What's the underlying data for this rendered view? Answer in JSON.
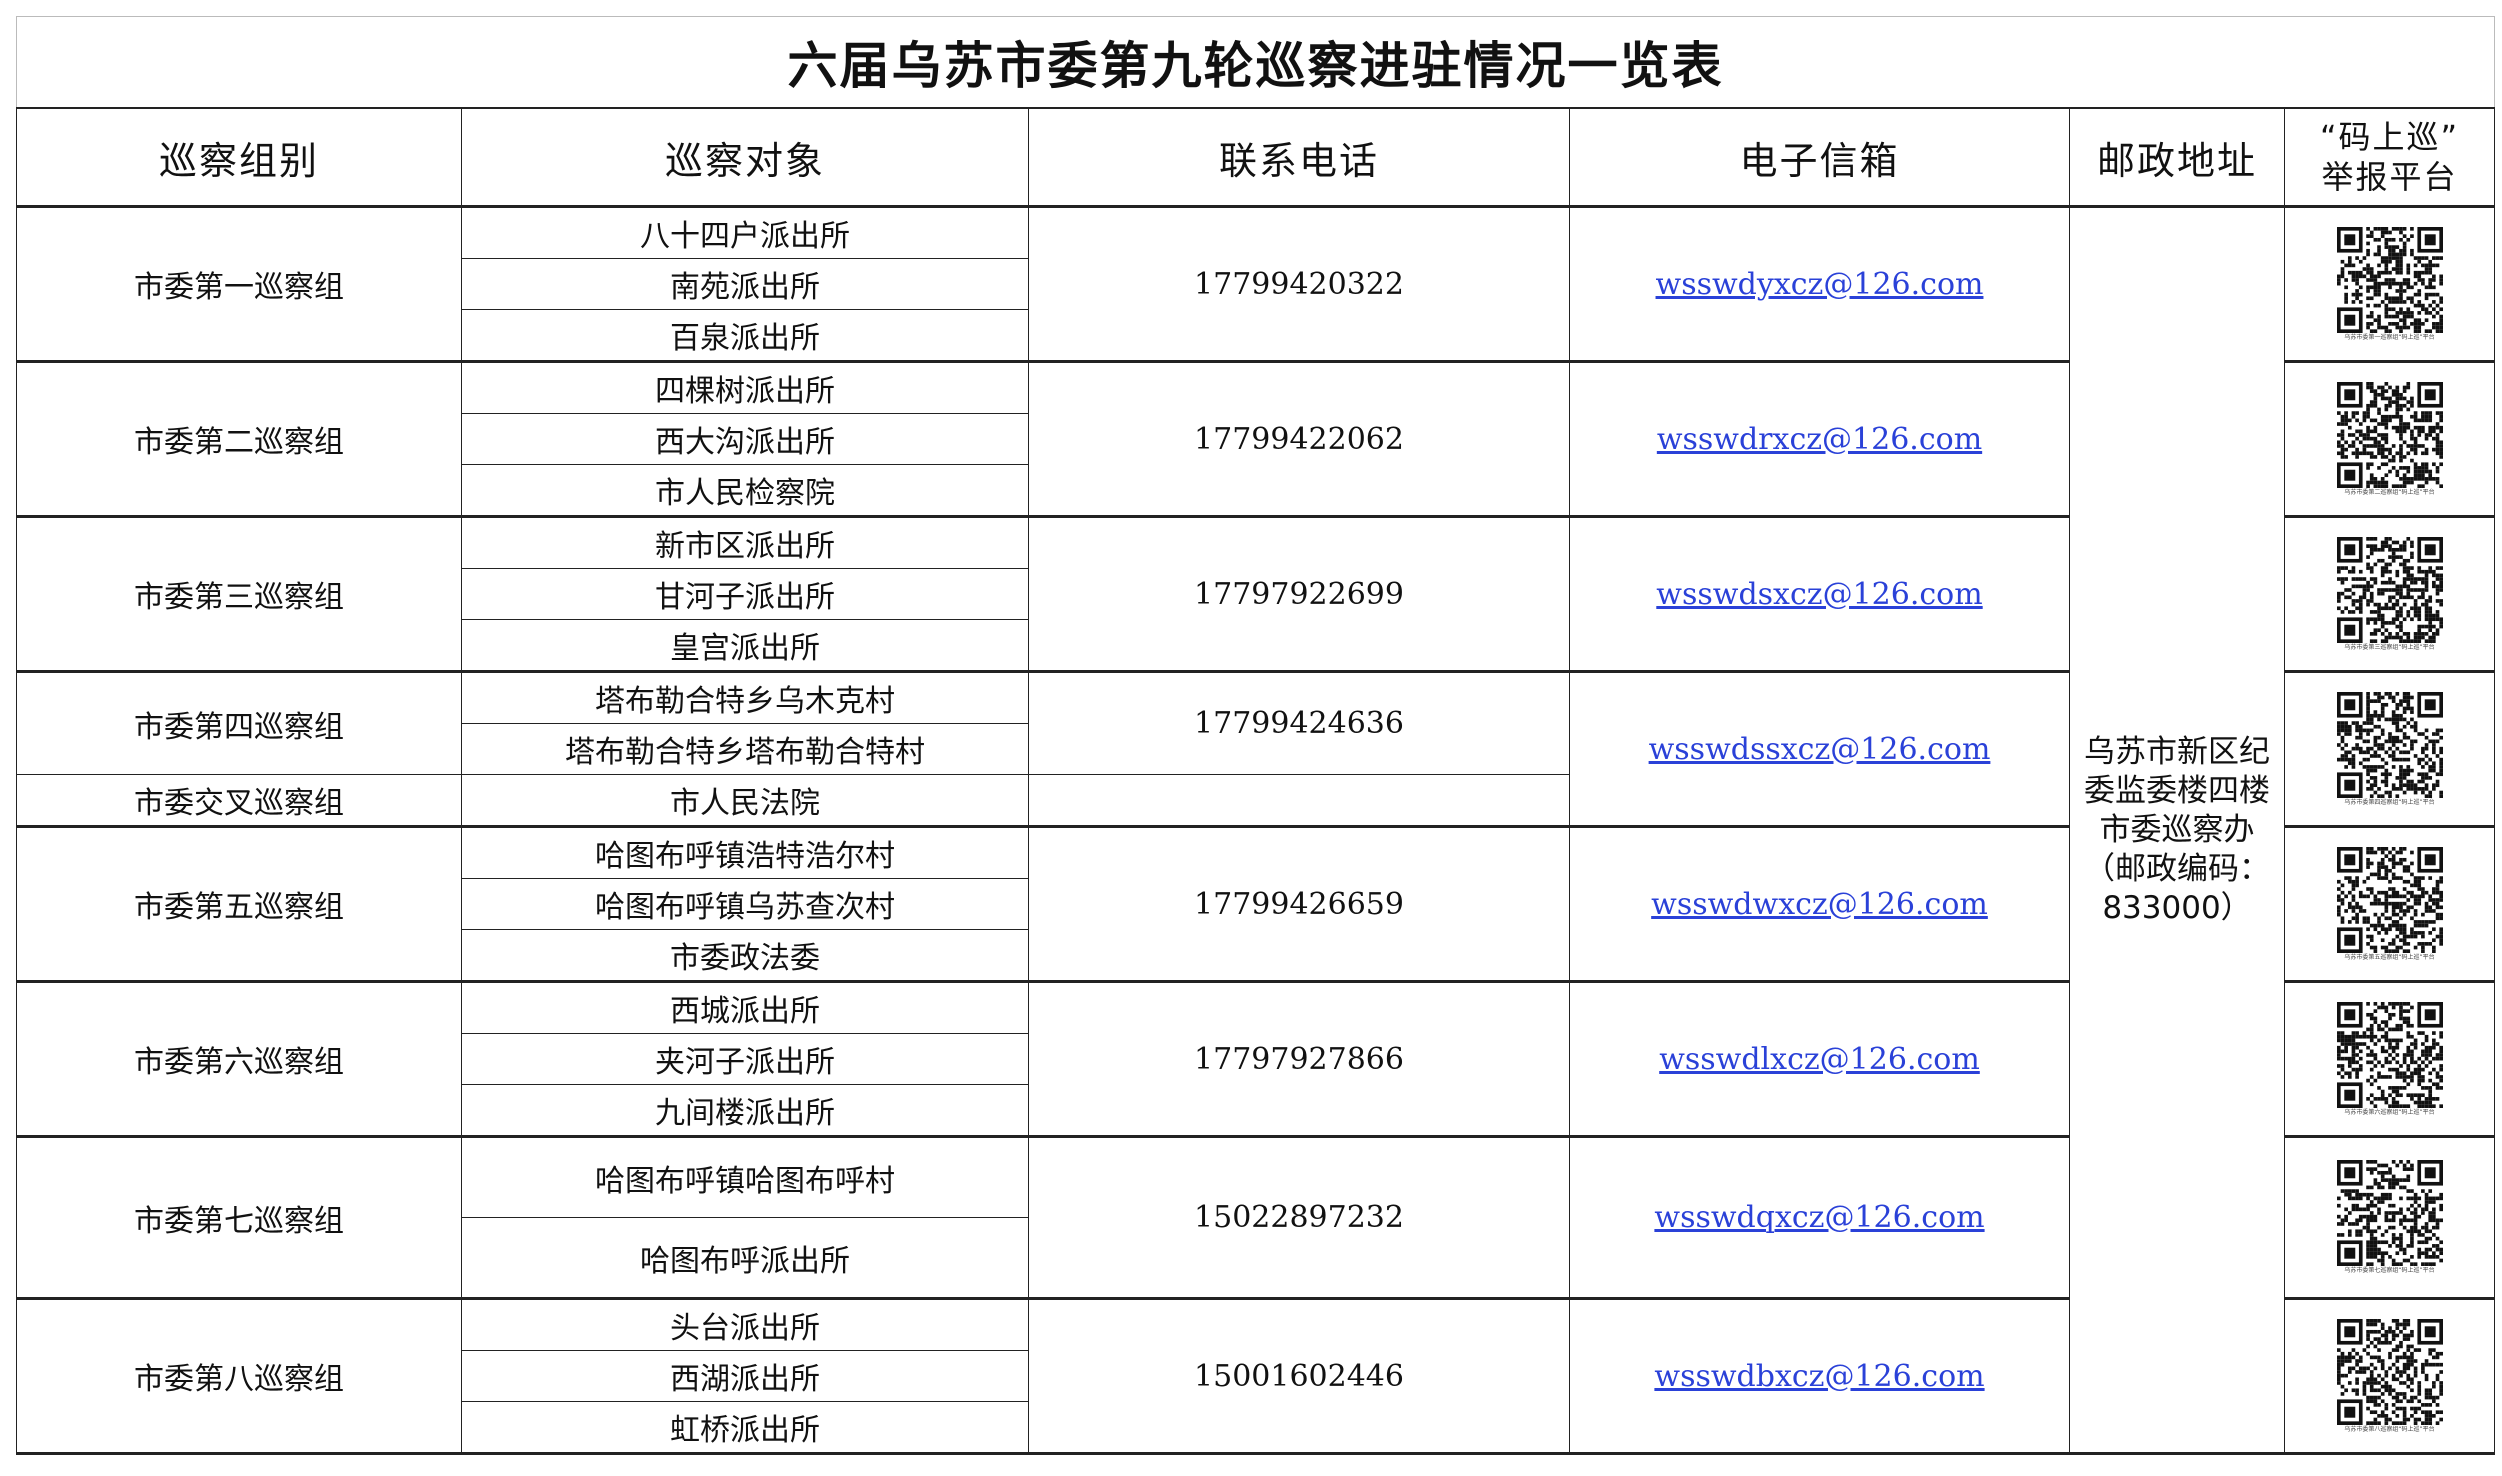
{
  "title": "六届乌苏市委第九轮巡察进驻情况一览表",
  "headers": {
    "group": "巡察组别",
    "target": "巡察对象",
    "phone": "联系电话",
    "email": "电子信箱",
    "address": "邮政地址",
    "qr_line1": "“码上巡”",
    "qr_line2": "举报平台"
  },
  "address": {
    "line1": "乌苏市新区纪",
    "line2": "委监委楼四楼",
    "line3": "市委巡察办",
    "line4": "（邮政编码：",
    "line5": "833000）"
  },
  "blocks": [
    {
      "group": "市委第一巡察组",
      "targets": [
        "八十四户派出所",
        "南苑派出所",
        "百泉派出所"
      ],
      "phone": "17799420322",
      "email": "wsswdyxcz@126.com",
      "qr_caption": "乌苏市委第一巡察组“码上巡”平台"
    },
    {
      "group": "市委第二巡察组",
      "targets": [
        "四棵树派出所",
        "西大沟派出所",
        "市人民检察院"
      ],
      "phone": "17799422062",
      "email": "wsswdrxcz@126.com",
      "qr_caption": "乌苏市委第二巡察组“码上巡”平台"
    },
    {
      "group": "市委第三巡察组",
      "targets": [
        "新市区派出所",
        "甘河子派出所",
        "皇宫派出所"
      ],
      "phone": "17797922699",
      "email": "wsswdsxcz@126.com",
      "qr_caption": "乌苏市委第三巡察组“码上巡”平台"
    },
    {
      "group": "市委第四巡察组",
      "group2": "市委交叉巡察组",
      "targets": [
        "塔布勒合特乡乌木克村",
        "塔布勒合特乡塔布勒合特村",
        "市人民法院"
      ],
      "phone": "17799424636",
      "email": "wsswdssxcz@126.com",
      "qr_caption": "乌苏市委第四巡察组“码上巡”平台"
    },
    {
      "group": "市委第五巡察组",
      "targets": [
        "哈图布呼镇浩特浩尔村",
        "哈图布呼镇乌苏查次村",
        "市委政法委"
      ],
      "phone": "17799426659",
      "email": "wsswdwxcz@126.com",
      "qr_caption": "乌苏市委第五巡察组“码上巡”平台"
    },
    {
      "group": "市委第六巡察组",
      "targets": [
        "西城派出所",
        "夹河子派出所",
        "九间楼派出所"
      ],
      "phone": "17797927866",
      "email": "wsswdlxcz@126.com",
      "qr_caption": "乌苏市委第六巡察组“码上巡”平台"
    },
    {
      "group": "市委第七巡察组",
      "targets": [
        "哈图布呼镇哈图布呼村",
        "哈图布呼派出所"
      ],
      "phone": "15022897232",
      "email": "wsswdqxcz@126.com",
      "qr_caption": "乌苏市委第七巡察组“码上巡”平台"
    },
    {
      "group": "市委第八巡察组",
      "targets": [
        "头台派出所",
        "西湖派出所",
        "虹桥派出所"
      ],
      "phone": "15001602446",
      "email": "wsswdbxcz@126.com",
      "qr_caption": "乌苏市委第八巡察组“码上巡”平台"
    }
  ]
}
